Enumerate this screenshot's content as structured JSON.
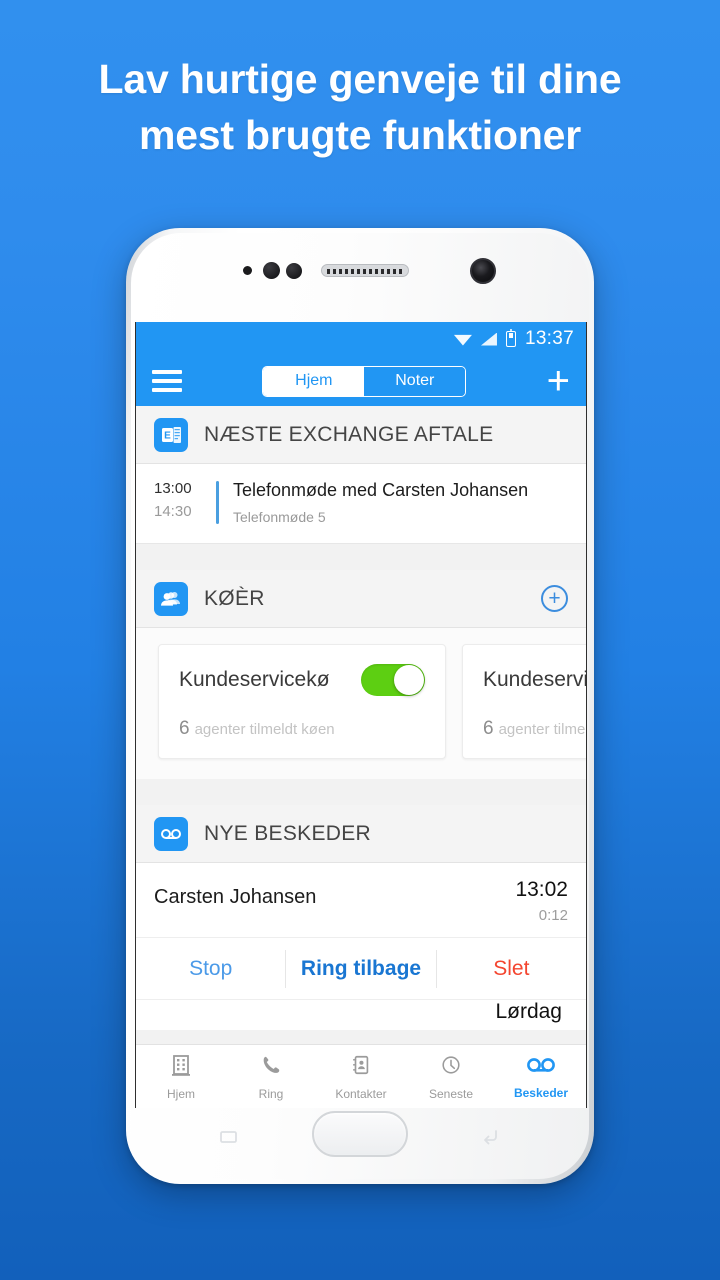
{
  "headline": {
    "line1": "Lav hurtige genveje til dine",
    "line2": "mest brugte funktioner"
  },
  "statusbar": {
    "time": "13:37",
    "wifi_icon": "wifi-icon",
    "signal_icon": "signal-icon",
    "battery_icon": "battery-icon"
  },
  "appbar": {
    "menu_icon": "hamburger-menu-icon",
    "tabs": [
      {
        "label": "Hjem",
        "active": true
      },
      {
        "label": "Noter",
        "active": false
      }
    ],
    "add_label": "+"
  },
  "exchange": {
    "icon": "exchange-outlook-icon",
    "title": "NÆSTE EXCHANGE AFTALE",
    "appointment": {
      "start_time": "13:00",
      "end_time": "14:30",
      "title": "Telefonmøde med Carsten Johansen",
      "subtitle": "Telefonmøde 5"
    }
  },
  "queues": {
    "icon": "queue-people-icon",
    "title": "KØÈR",
    "add_icon": "circle-plus-icon",
    "cards": [
      {
        "name": "Kundeservicekø",
        "enabled": true,
        "count": "6",
        "meta": "agenter tilmeldt køen"
      },
      {
        "name": "Kundeservicekø",
        "enabled": true,
        "count": "6",
        "meta": "agenter tilmeldt køen"
      }
    ]
  },
  "messages": {
    "icon": "voicemail-icon",
    "title": "NYE BESKEDER",
    "entry": {
      "name": "Carsten Johansen",
      "time": "13:02",
      "duration": "0:12"
    },
    "actions": {
      "stop": "Stop",
      "callback": "Ring tilbage",
      "delete": "Slet"
    },
    "next_entry_day": "Lørdag"
  },
  "bottomnav": [
    {
      "label": "Hjem",
      "icon": "building-icon",
      "active": false
    },
    {
      "label": "Ring",
      "icon": "phone-icon",
      "active": false
    },
    {
      "label": "Kontakter",
      "icon": "contacts-book-icon",
      "active": false
    },
    {
      "label": "Seneste",
      "icon": "clock-icon",
      "active": false
    },
    {
      "label": "Beskeder",
      "icon": "voicemail-icon",
      "active": true
    }
  ],
  "colors": {
    "brand_blue": "#2196f3",
    "background_top": "#3190ee",
    "background_bottom": "#1260bb",
    "toggle_green": "#5dcf12",
    "delete_red": "#f4452f"
  }
}
